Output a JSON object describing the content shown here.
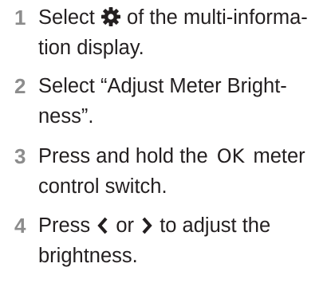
{
  "steps": [
    {
      "number": "1",
      "line1_before": "Select ",
      "line1_after": " of the multi-informa-",
      "line2": "tion display.",
      "icon": "gear-icon"
    },
    {
      "number": "2",
      "line1": "Select “Adjust Meter Bright-",
      "line2": "ness”."
    },
    {
      "number": "3",
      "line1_before": "Press and hold the ",
      "ok_label": "OK",
      "line1_after": " meter",
      "line2": "control switch."
    },
    {
      "number": "4",
      "line1_before": "Press ",
      "line1_mid": " or ",
      "line1_after": " to adjust the",
      "line2": "brightness.",
      "icons": [
        "chevron-left-icon",
        "chevron-right-icon"
      ]
    }
  ],
  "colors": {
    "step_number": "#8c8c8c",
    "text": "#231f20"
  }
}
